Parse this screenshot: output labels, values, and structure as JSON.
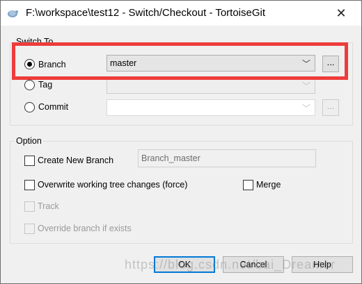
{
  "window": {
    "title": "F:\\workspace\\test12 - Switch/Checkout - TortoiseGit"
  },
  "switch_to": {
    "group_label": "Switch To",
    "branch": {
      "label": "Branch",
      "value": "master",
      "selected": true
    },
    "tag": {
      "label": "Tag",
      "value": ""
    },
    "commit": {
      "label": "Commit",
      "value": ""
    },
    "browse_label": "..."
  },
  "option": {
    "group_label": "Option",
    "create_new_branch": {
      "label": "Create New Branch",
      "value": "Branch_master",
      "checked": false
    },
    "overwrite": {
      "label": "Overwrite working tree changes (force)",
      "checked": false
    },
    "merge": {
      "label": "Merge",
      "checked": false
    },
    "track": {
      "label": "Track",
      "checked": false
    },
    "override_branch": {
      "label": "Override branch if exists",
      "checked": false
    }
  },
  "buttons": {
    "ok": "OK",
    "cancel": "Cancel",
    "help": "Help"
  },
  "watermark": "https://blog.csdn.net/bai_Dreamer",
  "colors": {
    "highlight": "#ee3b3b",
    "default_button_border": "#0078d7"
  }
}
